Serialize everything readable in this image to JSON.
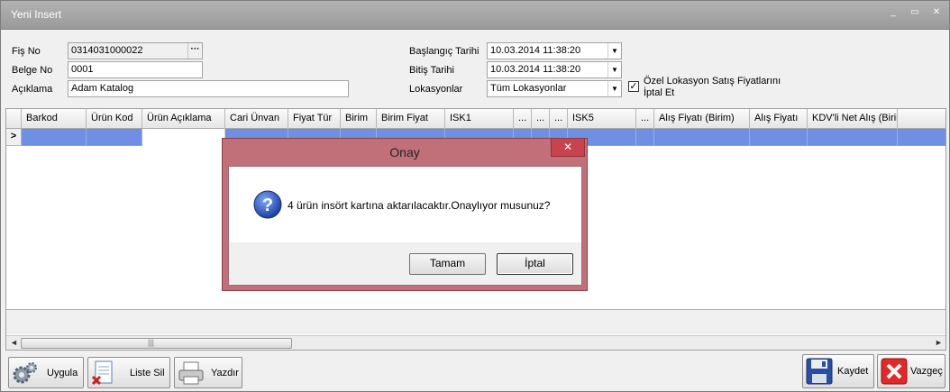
{
  "window": {
    "title": "Yeni Insert",
    "minimize_glyph": "_",
    "restore_glyph": "▭",
    "close_glyph": "✕"
  },
  "form": {
    "fis_no_label": "Fiş No",
    "fis_no_value": "0314031000022",
    "fis_no_button": "···",
    "belge_no_label": "Belge No",
    "belge_no_value": "0001",
    "aciklama_label": "Açıklama",
    "aciklama_value": "Adam Katalog",
    "baslangic_label": "Başlangıç Tarihi",
    "baslangic_value": "10.03.2014 11:38:20",
    "bitis_label": "Bitiş Tarihi",
    "bitis_value": "10.03.2014 11:38:20",
    "lokasyon_label": "Lokasyonlar",
    "lokasyon_value": "Tüm Lokasyonlar",
    "checkbox_checked": true,
    "checkbox_glyph": "✓",
    "checkbox_label_line1": "Özel Lokasyon Satış Fiyatlarını",
    "checkbox_label_line2": "İptal Et",
    "dropdown_glyph": "▼"
  },
  "grid": {
    "columns": [
      "",
      "Barkod",
      "Ürün Kod",
      "Ürün Açıklama",
      "Cari Ünvan",
      "Fiyat Tür",
      "Birim",
      "Birim Fiyat",
      "ISK1",
      "...",
      "...",
      "...",
      "ISK5",
      "...",
      "Alış Fiyatı (Birim)",
      "Alış Fiyatı",
      "KDV'li Net Alış (Birim)"
    ],
    "row_indicator": ">",
    "selected_row_color": "#6f8fe2",
    "scroll_left": "◄",
    "scroll_right": "►",
    "scroll_grip": "|||"
  },
  "toolbar": {
    "uygula_label": "Uygula",
    "liste_sil_label": "Liste Sil",
    "yazdir_label": "Yazdır",
    "kaydet_label": "Kaydet",
    "vazgec_label": "Vazgeç"
  },
  "dialog": {
    "title": "Onay",
    "close_glyph": "✕",
    "message": "4 ürün insört kartına aktarılacaktır.Onaylıyor musunuz?",
    "ok_label": "Tamam",
    "cancel_label": "İptal",
    "accent_color": "#c1707a"
  }
}
